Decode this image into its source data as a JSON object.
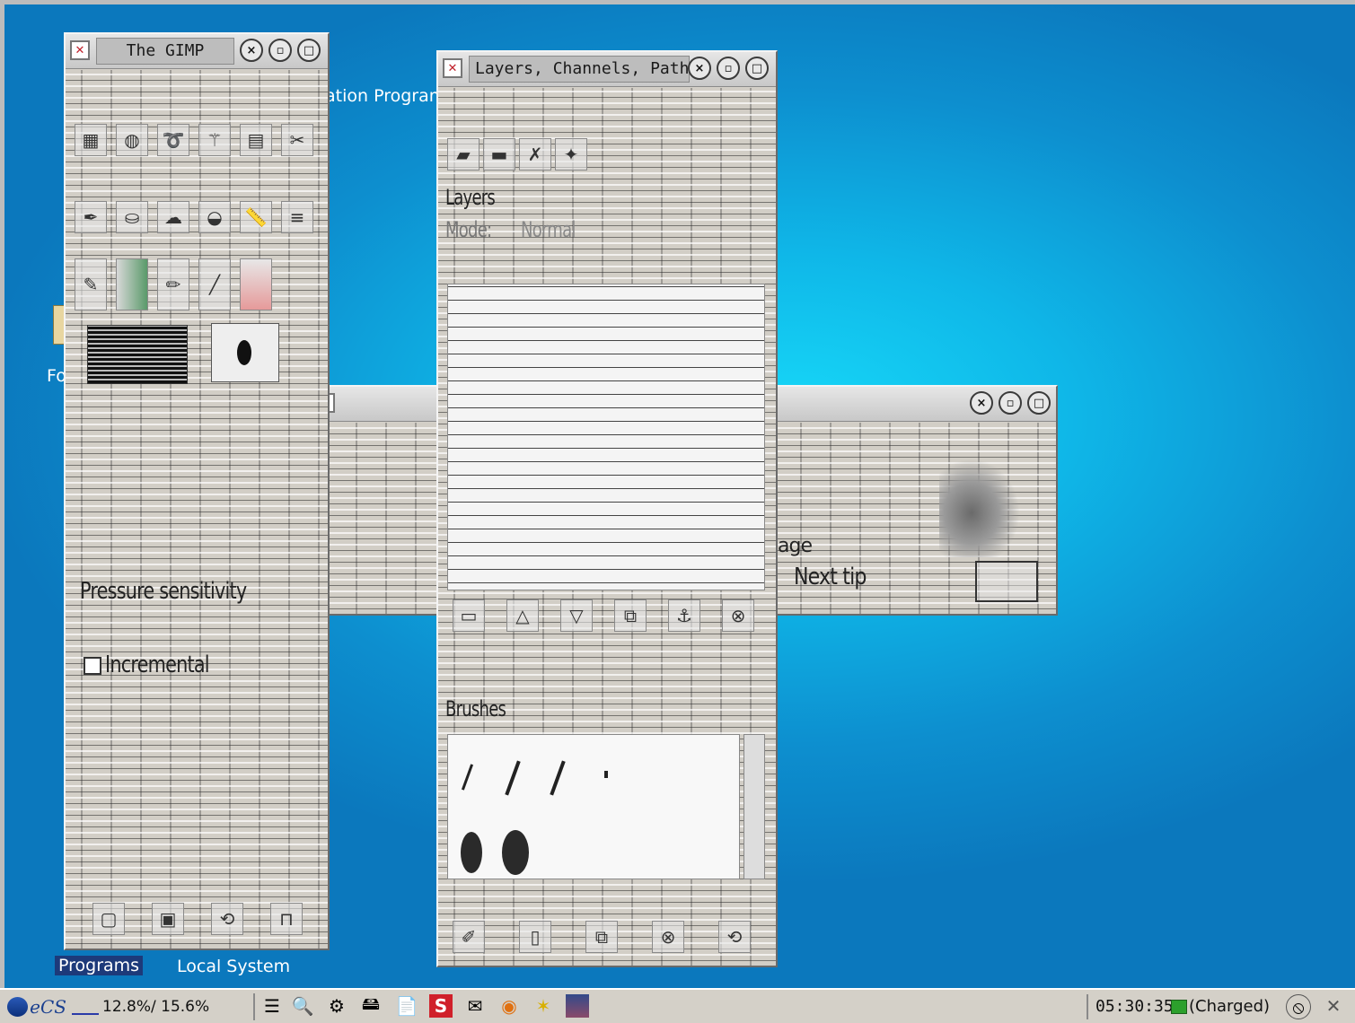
{
  "desktop": {
    "labels": {
      "integration_program": "ation Program",
      "folder_fragment": "Fo",
      "programs": "Programs",
      "local_system": "Local System"
    }
  },
  "windows": {
    "gimp": {
      "title": "The GIMP",
      "options": {
        "pressure": "Pressure sensitivity",
        "incremental": "Incremental"
      }
    },
    "layers": {
      "title": "Layers, Channels, Paths,",
      "layers_tab": "Layers",
      "mode_label": "Mode:",
      "mode_value": "Normal",
      "brushes_tab": "Brushes"
    },
    "tip": {
      "fragment_age": "age",
      "next_tip": "Next tip"
    }
  },
  "title_buttons": {
    "close": "×",
    "minimize": "▫",
    "maximize": "□"
  },
  "taskbar": {
    "logo": "eCS",
    "cpu_load": "12.8%/ 15.6%",
    "clock": "05:30:35",
    "battery": "(Charged)"
  }
}
